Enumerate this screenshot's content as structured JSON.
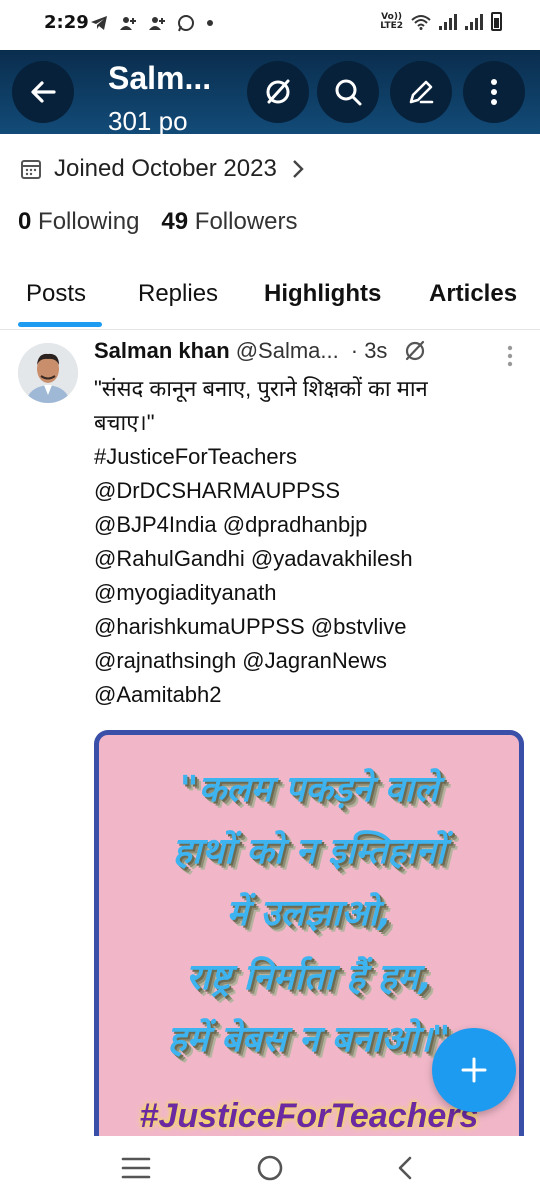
{
  "status_bar": {
    "time": "2:29",
    "left_icons": [
      "telegram-icon",
      "person-add-icon",
      "person-add-icon",
      "whatsapp-icon",
      "dot-icon"
    ],
    "network_label": "Vo)) LTE2"
  },
  "top_bar": {
    "title": "Salm...",
    "subtitle": "301 po",
    "background_color": "#0f3d63"
  },
  "profile": {
    "joined": "Joined October 2023",
    "following_count": "0",
    "following_label": "Following",
    "followers_count": "49",
    "followers_label": "Followers"
  },
  "tabs": [
    {
      "label": "Posts",
      "active": true
    },
    {
      "label": "Replies",
      "active": false
    },
    {
      "label": "Highlights",
      "active": false
    },
    {
      "label": "Articles",
      "active": false
    }
  ],
  "post": {
    "name": "Salman khan",
    "handle": "@Salma...",
    "time": "· 3s",
    "lines": [
      "\"संसद कानून बनाए, पुराने शिक्षकों का मान",
      "बचाए।\"",
      "#JusticeForTeachers",
      "@DrDCSHARMAUPPSS",
      "@BJP4India @dpradhanbjp",
      "@RahulGandhi @yadavakhilesh",
      "@myogiadityanath",
      "@harishkumaUPPSS @bstvlive",
      "@rajnathsingh @JagranNews",
      "@Aamitabh2"
    ],
    "image_lines": [
      "\"कलम पकड़ने वाले",
      "हाथों को न इम्तिहानों",
      "में उलझाओ,",
      "राष्ट्र निर्माता हैं हम,",
      "हमें बेबस न बनाओ।\""
    ],
    "image_hashtag": "#JusticeForTeachers"
  },
  "accent_color": "#1d9bf0"
}
